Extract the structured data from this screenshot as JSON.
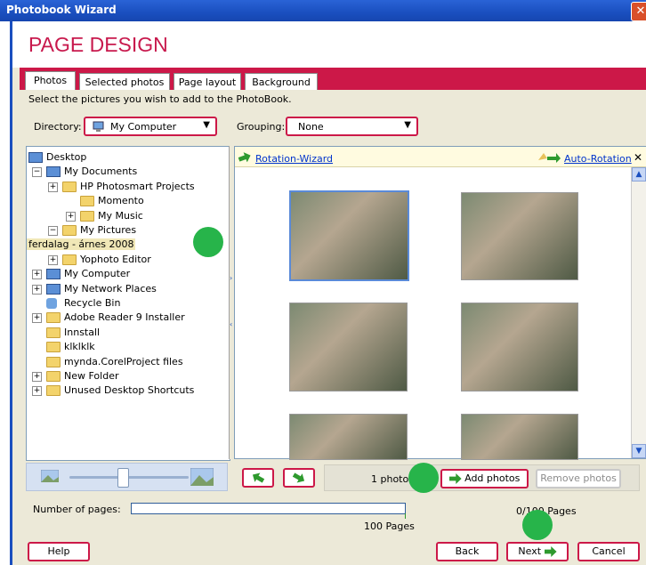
{
  "window": {
    "title": "Photobook Wizard",
    "close_glyph": "✕"
  },
  "page_heading": "PAGE DESIGN",
  "tabs": [
    {
      "label": "Photos",
      "active": true
    },
    {
      "label": "Selected photos",
      "active": false
    },
    {
      "label": "Page layout",
      "active": false
    },
    {
      "label": "Background",
      "active": false
    }
  ],
  "instruction": "Select the pictures you wish to add to the PhotoBook.",
  "directory": {
    "label": "Directory:",
    "value": "My Computer"
  },
  "grouping": {
    "label": "Grouping:",
    "value": "None"
  },
  "tree": [
    {
      "label": "Desktop",
      "icon": "desktop-icon",
      "expander": ""
    },
    {
      "label": "My Documents",
      "icon": "my-documents-icon",
      "expander": "−"
    },
    {
      "label": "HP Photosmart Projects",
      "icon": "folder-icon",
      "expander": "+"
    },
    {
      "label": "Momento",
      "icon": "folder-icon",
      "expander": ""
    },
    {
      "label": "My Music",
      "icon": "music-folder-icon",
      "expander": "+"
    },
    {
      "label": "My Pictures",
      "icon": "pictures-folder-icon",
      "expander": "−"
    },
    {
      "label": "ferdalag - árnes 2008",
      "icon": "folder-open-icon",
      "expander": ""
    },
    {
      "label": "Yophoto Editor",
      "icon": "folder-icon",
      "expander": "+"
    },
    {
      "label": "My Computer",
      "icon": "computer-icon",
      "expander": "+"
    },
    {
      "label": "My Network Places",
      "icon": "network-icon",
      "expander": "+"
    },
    {
      "label": "Recycle Bin",
      "icon": "recycle-bin-icon",
      "expander": ""
    },
    {
      "label": "Adobe Reader 9 Installer",
      "icon": "folder-icon",
      "expander": "+"
    },
    {
      "label": "Innstall",
      "icon": "folder-icon",
      "expander": ""
    },
    {
      "label": "klklklk",
      "icon": "folder-icon",
      "expander": ""
    },
    {
      "label": "mynda.CorelProject files",
      "icon": "folder-icon",
      "expander": ""
    },
    {
      "label": "New Folder",
      "icon": "folder-icon",
      "expander": "+"
    },
    {
      "label": "Unused Desktop Shortcuts",
      "icon": "folder-icon",
      "expander": "+"
    }
  ],
  "photo_header": {
    "rotation_wizard": "Rotation-Wizard",
    "auto_rotation": "Auto-Rotation",
    "close_glyph": "✕"
  },
  "toolbar": {
    "photo_count": "1 photo",
    "add_photos": "Add photos",
    "remove_photos": "Remove photos",
    "zoom_level": 0.44
  },
  "pages": {
    "label": "Number of pages:",
    "max_label": "100 Pages",
    "status": "0/100 Pages",
    "current": 0,
    "max": 100
  },
  "footer": {
    "help": "Help",
    "back": "Back",
    "next": "Next",
    "cancel": "Cancel"
  }
}
